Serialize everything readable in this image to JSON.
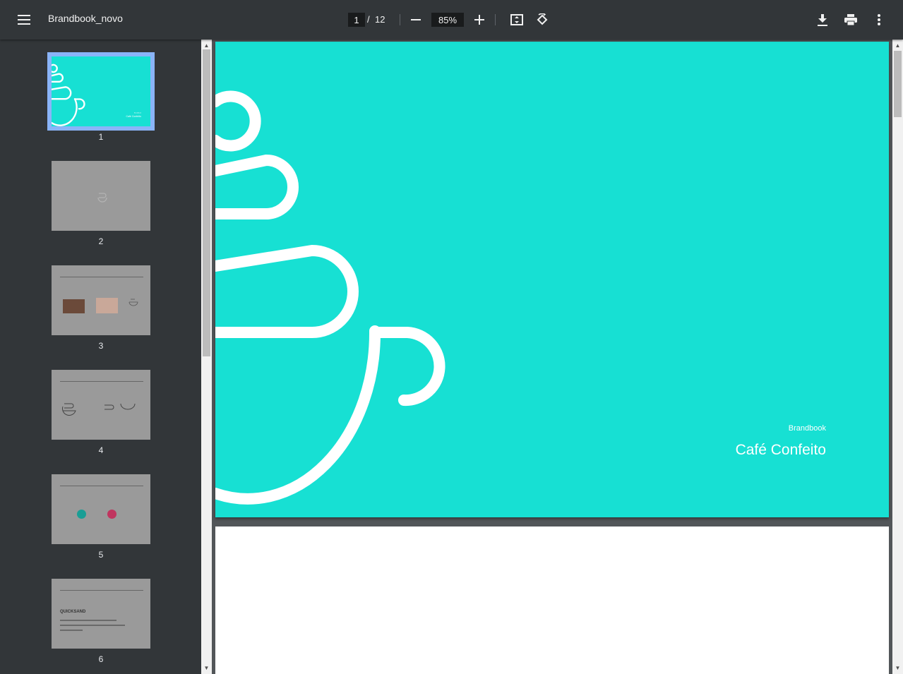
{
  "toolbar": {
    "title": "Brandbook_novo",
    "page_current": "1",
    "page_separator": "/",
    "page_total": "12",
    "zoom": "85%",
    "icons": [
      "menu-icon",
      "zoom-out-icon",
      "zoom-in-icon",
      "fit-page-icon",
      "rotate-icon",
      "download-icon",
      "print-icon",
      "more-vert-icon"
    ]
  },
  "sidebar": {
    "thumbnails": [
      {
        "number": "1",
        "active": true
      },
      {
        "number": "2",
        "active": false
      },
      {
        "number": "3",
        "active": false
      },
      {
        "number": "4",
        "active": false
      },
      {
        "number": "5",
        "active": false
      },
      {
        "number": "6",
        "active": false
      }
    ],
    "thumb6_text": "QUICKSAND"
  },
  "page1": {
    "subtitle": "Brandbook",
    "title": "Café Confeito",
    "background": "#17e0d3"
  },
  "colors": {
    "toolbar": "#323639",
    "viewer_bg": "#525659",
    "accent": "#8ab4f8",
    "page_teal": "#17e0d3"
  }
}
